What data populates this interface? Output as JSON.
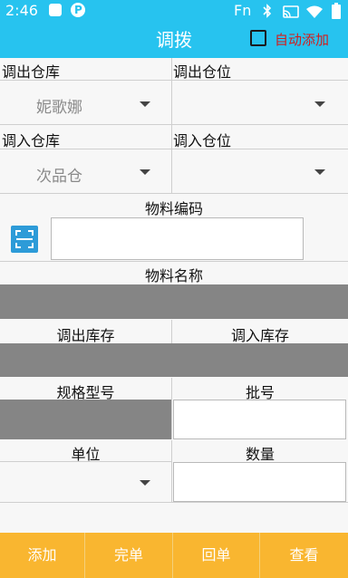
{
  "status_bar": {
    "time": "2:46",
    "network": "Fn"
  },
  "header": {
    "title": "调拨",
    "auto_add_label": "自动添加",
    "auto_add_checked": false
  },
  "form": {
    "out_warehouse_label": "调出仓库",
    "out_warehouse_value": "妮歌娜",
    "out_location_label": "调出仓位",
    "out_location_value": "",
    "in_warehouse_label": "调入仓库",
    "in_warehouse_value": "次品仓",
    "in_location_label": "调入仓位",
    "in_location_value": "",
    "material_code_label": "物料编码",
    "material_code_value": "",
    "material_name_label": "物料名称",
    "material_name_value": "",
    "out_stock_label": "调出库存",
    "in_stock_label": "调入库存",
    "stock_value": "",
    "spec_label": "规格型号",
    "spec_value": "",
    "batch_label": "批号",
    "batch_value": "",
    "unit_label": "单位",
    "unit_value": "",
    "quantity_label": "数量",
    "quantity_value": ""
  },
  "bottom_bar": {
    "add": "添加",
    "complete": "完单",
    "return": "回单",
    "view": "查看"
  },
  "colors": {
    "accent": "#27c3ef",
    "bottom_bar": "#f9b630",
    "checkbox_label": "#d21e1e",
    "readonly_field": "#858585"
  },
  "icons": {
    "scan": "scan-icon",
    "dropdown": "caret-down-icon"
  }
}
